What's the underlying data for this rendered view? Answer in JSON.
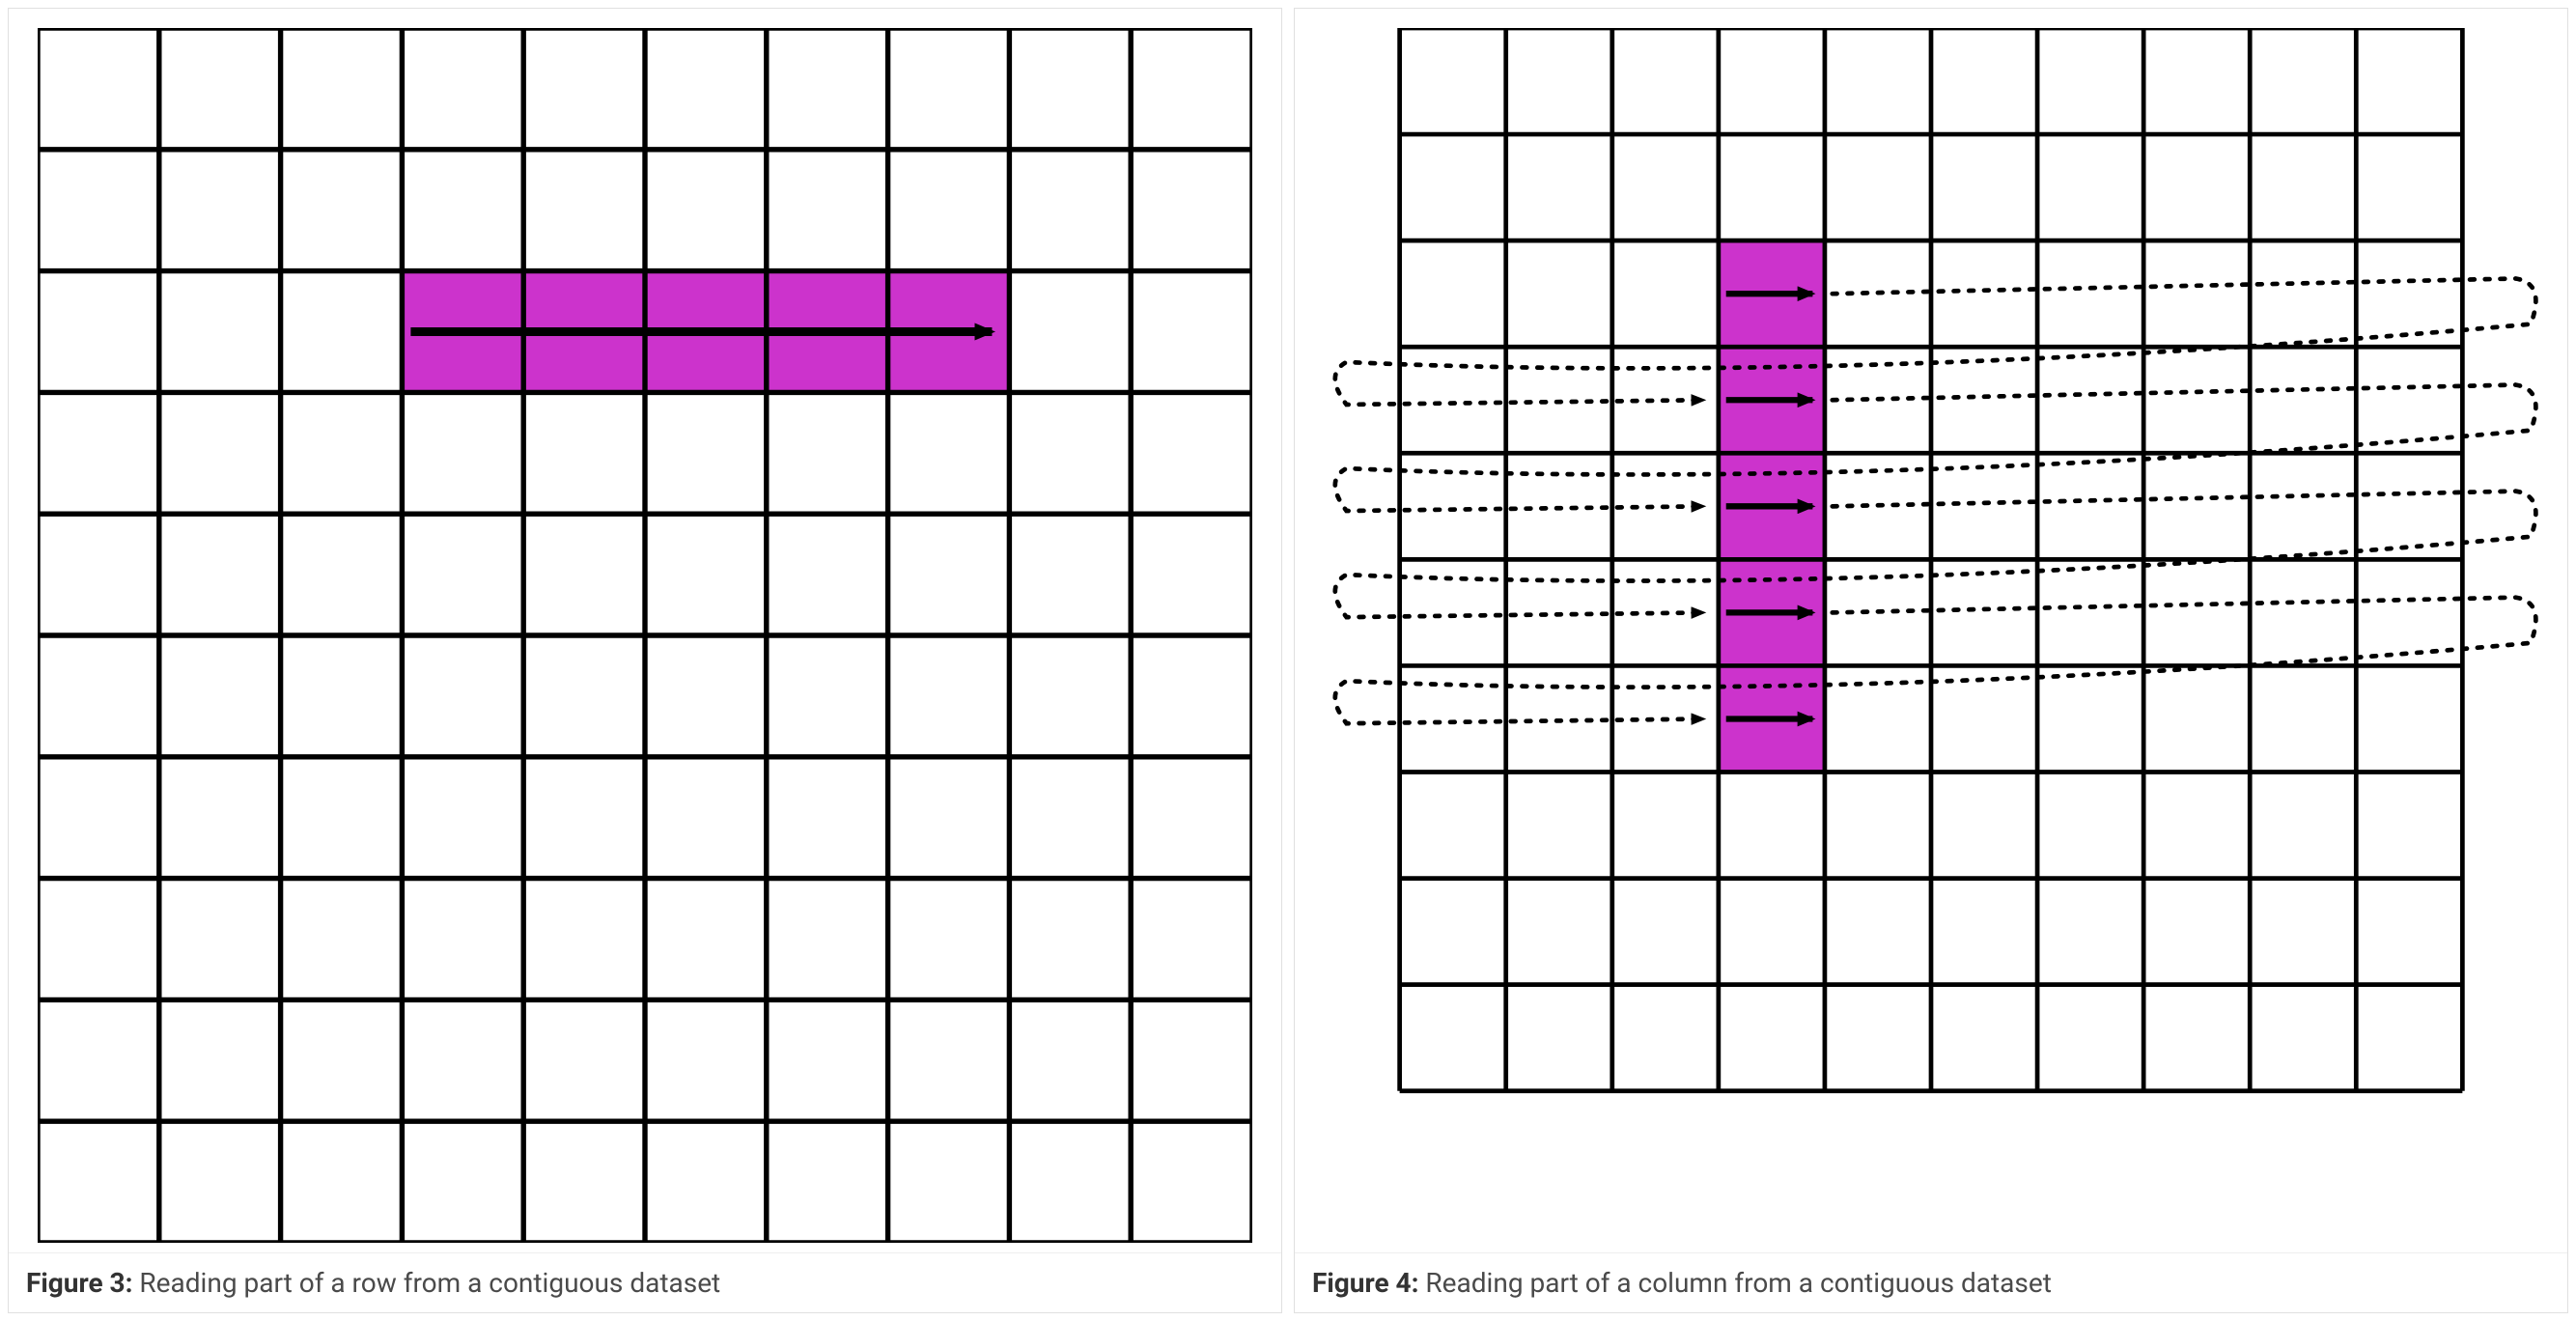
{
  "figures": {
    "left": {
      "label_prefix": "Figure 3:",
      "caption": " Reading part of a row from a contiguous dataset",
      "grid": {
        "rows": 10,
        "cols": 10
      },
      "highlight": {
        "type": "row-segment",
        "row": 2,
        "col_start": 3,
        "col_end": 7,
        "color": "#cc33cc"
      },
      "arrow": {
        "from": {
          "row": 2,
          "col": 3
        },
        "to": {
          "row": 2,
          "col": 7
        },
        "style": "solid"
      }
    },
    "right": {
      "label_prefix": "Figure 4:",
      "caption": " Reading part of a column from a contiguous dataset",
      "grid": {
        "rows": 10,
        "cols": 10
      },
      "highlight": {
        "type": "column-segment",
        "col": 3,
        "row_start": 2,
        "row_end": 6,
        "color": "#cc33cc"
      },
      "wrap_arrows": {
        "rows": [
          2,
          3,
          4,
          5,
          6
        ],
        "col": 3,
        "style_solid_segment": true,
        "style_dotted_wrap": true
      }
    }
  },
  "colors": {
    "grid_line": "#000000",
    "highlight": "#cc33cc",
    "arrow": "#000000",
    "panel_border": "#e0e0e0",
    "caption_text": "#4a4a4a"
  }
}
